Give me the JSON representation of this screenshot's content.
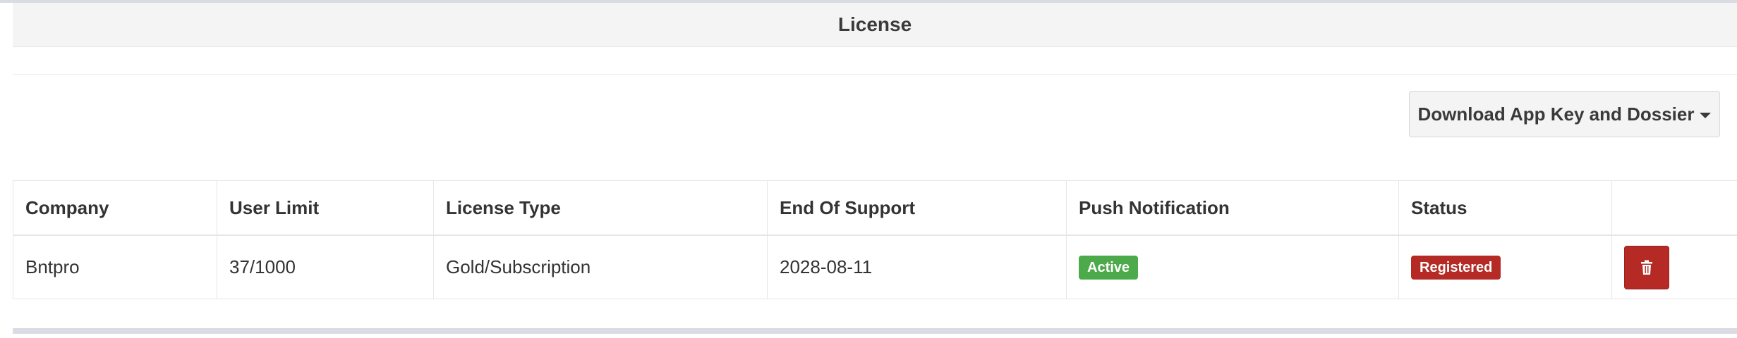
{
  "panel": {
    "title": "License"
  },
  "toolbar": {
    "download_label": "Download App Key and Dossier"
  },
  "table": {
    "columns": [
      "Company",
      "User Limit",
      "License Type",
      "End Of Support",
      "Push Notification",
      "Status",
      ""
    ],
    "rows": [
      {
        "company": "Bntpro",
        "user_limit": "37/1000",
        "license_type": "Gold/Subscription",
        "end_of_support": "2028-08-11",
        "push_notification": "Active",
        "status": "Registered"
      }
    ]
  },
  "colors": {
    "active_badge": "#4caa4a",
    "registered_badge": "#b52a24",
    "delete_button": "#b52a24"
  },
  "icons": {
    "delete": "trash-icon",
    "dropdown": "caret-down-icon"
  }
}
